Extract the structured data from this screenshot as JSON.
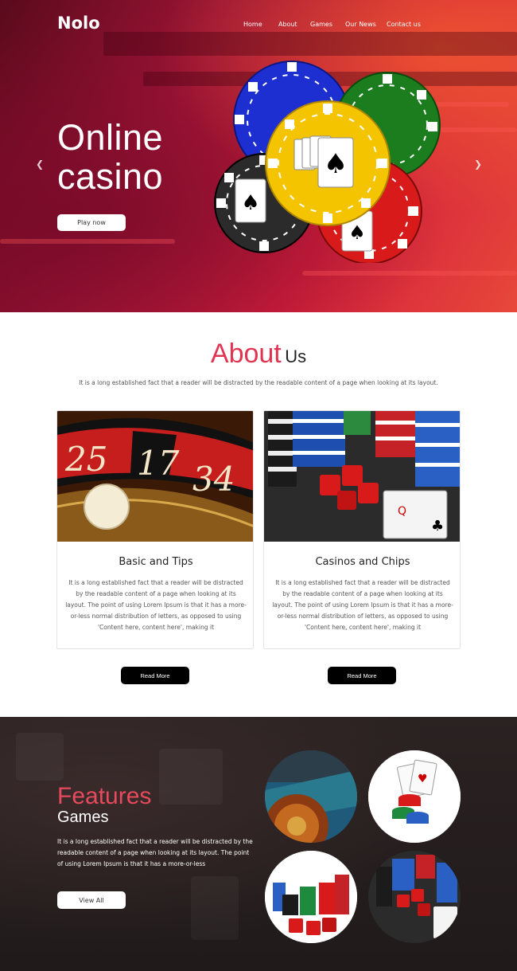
{
  "header": {
    "brand": "Nolo",
    "nav": [
      "Home",
      "About",
      "Games",
      "Our News",
      "Contact us"
    ]
  },
  "hero": {
    "title": "Online casino",
    "button": "Play now",
    "prev_icon": "chevron-left-icon",
    "next_icon": "chevron-right-icon"
  },
  "about": {
    "title_accent": "About",
    "title_rest": "Us",
    "subtitle": "It is a long established fact that a reader will be distracted by the readable content of a page when looking at its layout.",
    "cards": [
      {
        "title": "Basic and Tips",
        "text": "It is a long established fact that a reader will be distracted by the readable content of a page when looking at its layout. The point of using Lorem Ipsum is that it has a more-or-less normal distribution of letters, as opposed to using 'Content here, content here', making it",
        "button": "Read More"
      },
      {
        "title": "Casinos and Chips",
        "text": "It is a long established fact that a reader will be distracted by the readable content of a page when looking at its layout. The point of using Lorem Ipsum is that it has a more-or-less normal distribution of letters, as opposed to using 'Content here, content here', making it",
        "button": "Read More"
      }
    ]
  },
  "features": {
    "title": "Features",
    "subtitle": "Games",
    "text": "It is a long established fact that a reader will be distracted by the readable content of a page when looking at its layout. The point of using Lorem Ipsum is that it has a more-or-less",
    "button": "View All"
  },
  "colors": {
    "accent": "#e03552",
    "hero_red": "#d21e3c",
    "dark_bg": "#231c1c"
  }
}
